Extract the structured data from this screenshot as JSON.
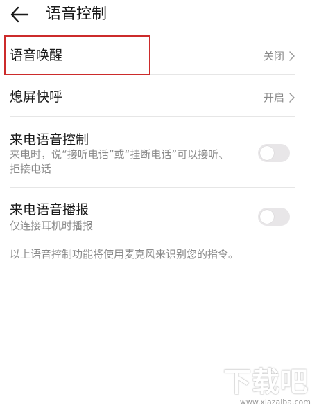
{
  "header": {
    "title": "语音控制",
    "back_icon": "arrow-left-icon"
  },
  "settings": {
    "voice_wakeup": {
      "title": "语音唤醒",
      "value": "关闭"
    },
    "screen_off_quick_call": {
      "title": "熄屏快呼",
      "value": "开启"
    },
    "incoming_call_voice_control": {
      "title": "来电语音控制",
      "subtitle": "来电时，说“接听电话”或“挂断电话”可以接听、拒接电话",
      "enabled": false
    },
    "incoming_call_announce": {
      "title": "来电语音播报",
      "subtitle": "仅连接耳机时播报",
      "enabled": false
    }
  },
  "footer": {
    "note": "以上语音控制功能将使用麦克风来识别您的指令。"
  },
  "watermark": {
    "logo_text": "下载吧",
    "url": "www.xiazaiba.com"
  },
  "colors": {
    "highlight": "#cc2b2b",
    "toggle_off": "#e8e6e8",
    "secondary_text": "#8a8a8a"
  }
}
